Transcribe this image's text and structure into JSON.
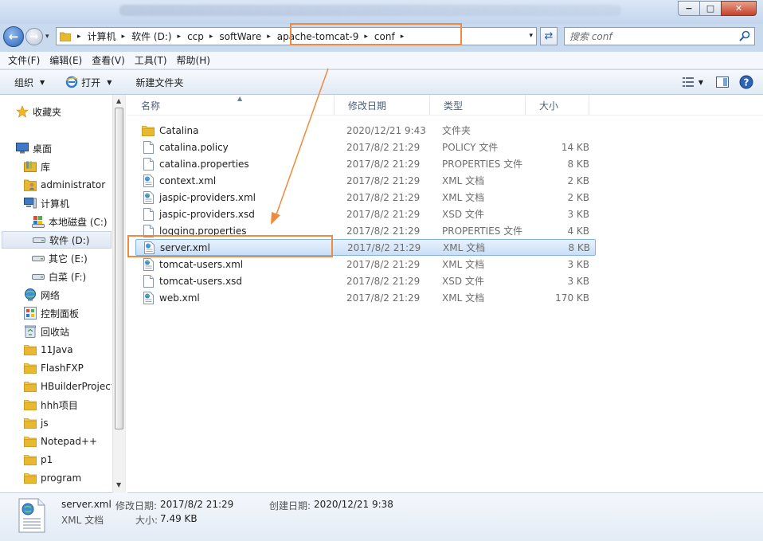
{
  "window": {
    "minimize_glyph": "−",
    "maximize_glyph": "□",
    "close_glyph": "✕"
  },
  "address": {
    "crumbs": [
      "计算机",
      "软件 (D:)",
      "ccp",
      "softWare",
      "apache-tomcat-9",
      "conf"
    ],
    "search_placeholder": "搜索 conf"
  },
  "menu": [
    "文件(F)",
    "编辑(E)",
    "查看(V)",
    "工具(T)",
    "帮助(H)"
  ],
  "toolbar": {
    "organize": "组织",
    "open": "打开",
    "new_folder": "新建文件夹"
  },
  "nav": [
    {
      "label": "收藏夹",
      "icon": "star-icon"
    },
    {
      "label": "桌面",
      "icon": "desktop-icon"
    },
    {
      "label": "库",
      "icon": "library-icon"
    },
    {
      "label": "administrator",
      "icon": "user-folder-icon"
    },
    {
      "label": "计算机",
      "icon": "computer-icon"
    },
    {
      "label": "本地磁盘 (C:)",
      "icon": "system-drive-icon"
    },
    {
      "label": "软件 (D:)",
      "icon": "drive-icon"
    },
    {
      "label": "其它 (E:)",
      "icon": "drive-icon"
    },
    {
      "label": "白菜 (F:)",
      "icon": "drive-icon"
    },
    {
      "label": "网络",
      "icon": "network-icon"
    },
    {
      "label": "控制面板",
      "icon": "control-panel-icon"
    },
    {
      "label": "回收站",
      "icon": "recycle-bin-icon"
    },
    {
      "label": "11Java",
      "icon": "folder-icon"
    },
    {
      "label": "FlashFXP",
      "icon": "folder-icon"
    },
    {
      "label": "HBuilderProjects",
      "icon": "folder-icon"
    },
    {
      "label": "hhh项目",
      "icon": "folder-icon"
    },
    {
      "label": "js",
      "icon": "folder-icon"
    },
    {
      "label": "Notepad++",
      "icon": "folder-icon"
    },
    {
      "label": "p1",
      "icon": "folder-icon"
    },
    {
      "label": "program",
      "icon": "folder-icon"
    }
  ],
  "columns": [
    "名称",
    "修改日期",
    "类型",
    "大小"
  ],
  "files": [
    {
      "name": "Catalina",
      "date": "2020/12/21 9:43",
      "type": "文件夹",
      "size": "",
      "icon": "folder-icon"
    },
    {
      "name": "catalina.policy",
      "date": "2017/8/2 21:29",
      "type": "POLICY 文件",
      "size": "14 KB",
      "icon": "file-icon"
    },
    {
      "name": "catalina.properties",
      "date": "2017/8/2 21:29",
      "type": "PROPERTIES 文件",
      "size": "8 KB",
      "icon": "file-icon"
    },
    {
      "name": "context.xml",
      "date": "2017/8/2 21:29",
      "type": "XML 文档",
      "size": "2 KB",
      "icon": "xml-file-icon"
    },
    {
      "name": "jaspic-providers.xml",
      "date": "2017/8/2 21:29",
      "type": "XML 文档",
      "size": "2 KB",
      "icon": "xml-file-icon"
    },
    {
      "name": "jaspic-providers.xsd",
      "date": "2017/8/2 21:29",
      "type": "XSD 文件",
      "size": "3 KB",
      "icon": "file-icon"
    },
    {
      "name": "logging.properties",
      "date": "2017/8/2 21:29",
      "type": "PROPERTIES 文件",
      "size": "4 KB",
      "icon": "file-icon"
    },
    {
      "name": "server.xml",
      "date": "2017/8/2 21:29",
      "type": "XML 文档",
      "size": "8 KB",
      "icon": "xml-file-icon",
      "selected": true
    },
    {
      "name": "tomcat-users.xml",
      "date": "2017/8/2 21:29",
      "type": "XML 文档",
      "size": "3 KB",
      "icon": "xml-file-icon"
    },
    {
      "name": "tomcat-users.xsd",
      "date": "2017/8/2 21:29",
      "type": "XSD 文件",
      "size": "3 KB",
      "icon": "file-icon"
    },
    {
      "name": "web.xml",
      "date": "2017/8/2 21:29",
      "type": "XML 文档",
      "size": "170 KB",
      "icon": "xml-file-icon"
    }
  ],
  "details": {
    "name": "server.xml",
    "type": "XML 文档",
    "modified_label": "修改日期:",
    "modified": "2017/8/2 21:29",
    "created_label": "创建日期:",
    "created": "2020/12/21 9:38",
    "size_label": "大小:",
    "size": "7.49 KB"
  },
  "colors": {
    "annotation": "#f08a3c",
    "selection_border": "#7eb4ea",
    "folder": "#e8b830"
  }
}
